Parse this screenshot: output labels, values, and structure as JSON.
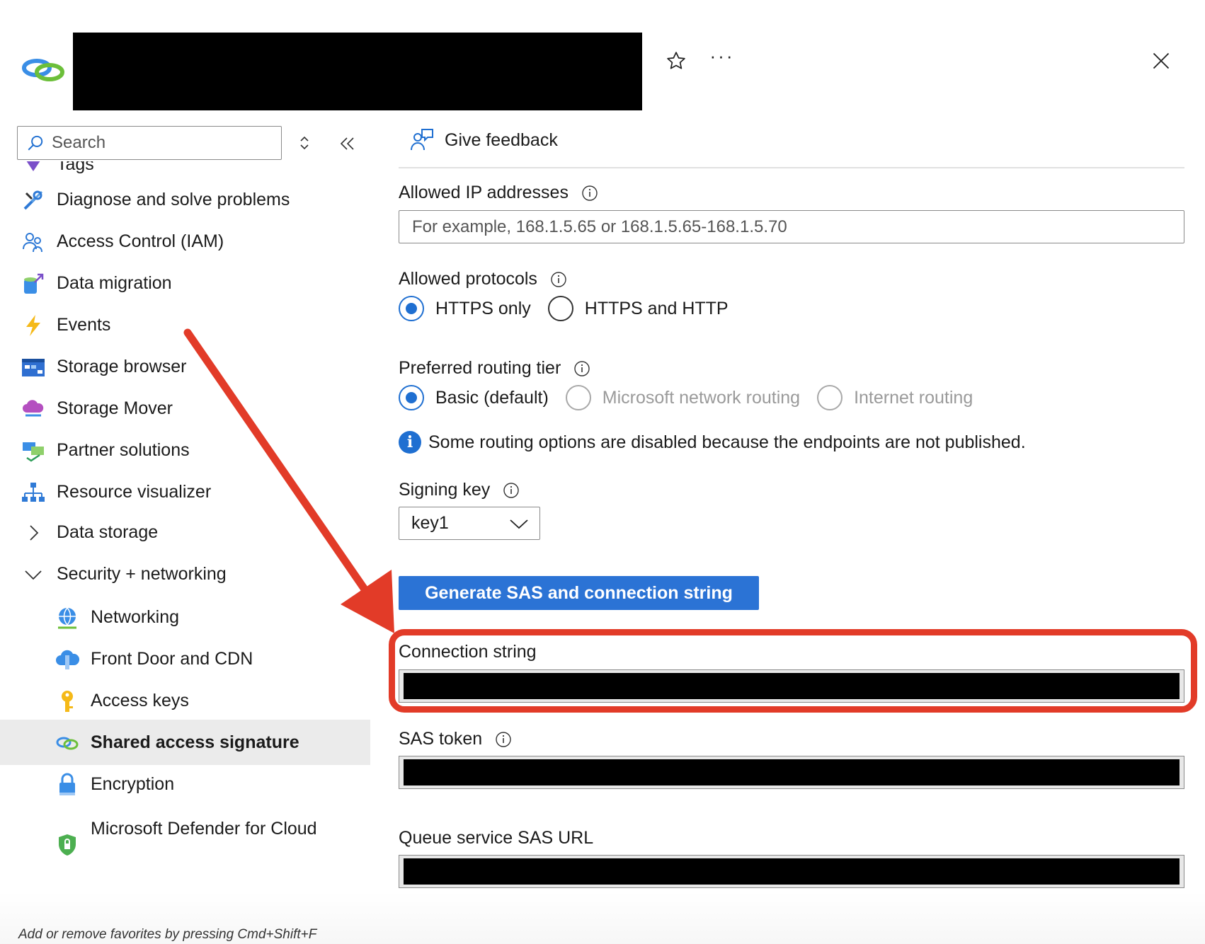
{
  "header": {
    "star_icon": "star-icon",
    "more_label": "···",
    "close_icon": "close-icon"
  },
  "sidebar": {
    "search_placeholder": "Search",
    "items": [
      {
        "label": "Tags",
        "icon": "tag-icon"
      },
      {
        "label": "Diagnose and solve problems",
        "icon": "wrench-icon"
      },
      {
        "label": "Access Control (IAM)",
        "icon": "people-icon"
      },
      {
        "label": "Data migration",
        "icon": "data-migration-icon"
      },
      {
        "label": "Events",
        "icon": "lightning-icon"
      },
      {
        "label": "Storage browser",
        "icon": "storage-browser-icon"
      },
      {
        "label": "Storage Mover",
        "icon": "cloud-icon"
      },
      {
        "label": "Partner solutions",
        "icon": "partner-icon"
      },
      {
        "label": "Resource visualizer",
        "icon": "hierarchy-icon"
      },
      {
        "label": "Data storage",
        "icon": "chevron-right-icon"
      },
      {
        "label": "Security + networking",
        "icon": "chevron-down-icon"
      },
      {
        "label": "Networking",
        "icon": "globe-icon"
      },
      {
        "label": "Front Door and CDN",
        "icon": "cloud-cdn-icon"
      },
      {
        "label": "Access keys",
        "icon": "key-icon"
      },
      {
        "label": "Shared access signature",
        "icon": "link-icon"
      },
      {
        "label": "Encryption",
        "icon": "lock-icon"
      },
      {
        "label": "Microsoft Defender for Cloud",
        "icon": "shield-icon"
      }
    ],
    "footer_hint": "Add or remove favorites by pressing Cmd+Shift+F"
  },
  "main": {
    "feedback_label": "Give feedback",
    "allowed_ip": {
      "label": "Allowed IP addresses",
      "placeholder": "For example, 168.1.5.65 or 168.1.5.65-168.1.5.70",
      "value": ""
    },
    "allowed_protocols": {
      "label": "Allowed protocols",
      "options": [
        "HTTPS only",
        "HTTPS and HTTP"
      ],
      "selected": "HTTPS only"
    },
    "routing_tier": {
      "label": "Preferred routing tier",
      "options": [
        "Basic (default)",
        "Microsoft network routing",
        "Internet routing"
      ],
      "selected": "Basic (default)",
      "disabled": [
        "Microsoft network routing",
        "Internet routing"
      ]
    },
    "info_message": "Some routing options are disabled because the endpoints are not published.",
    "signing_key": {
      "label": "Signing key",
      "value": "key1"
    },
    "generate_button": "Generate SAS and connection string",
    "connection_string_label": "Connection string",
    "sas_token_label": "SAS token",
    "queue_sas_url_label": "Queue service SAS URL"
  },
  "colors": {
    "accent": "#2b73d5",
    "annotation": "#e23b28",
    "redaction": "#000000"
  }
}
